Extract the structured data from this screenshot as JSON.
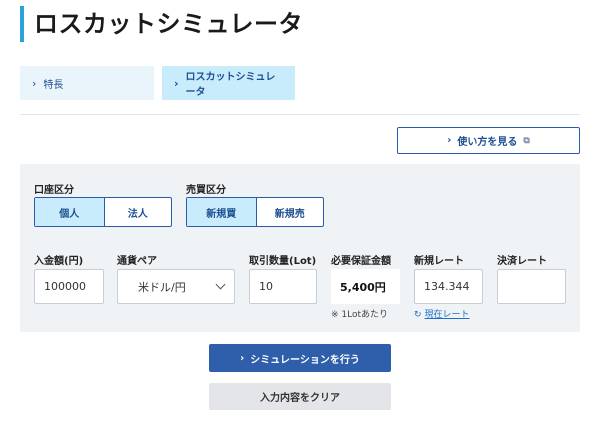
{
  "page": {
    "title": "ロスカットシミュレータ"
  },
  "tabs": [
    {
      "label": "特長"
    },
    {
      "label": "ロスカットシミュレータ"
    }
  ],
  "help_button": {
    "label": "使い方を見る"
  },
  "account_type": {
    "label": "口座区分",
    "options": [
      "個人",
      "法人"
    ],
    "selected": "個人"
  },
  "trade_type": {
    "label": "売買区分",
    "options": [
      "新規買",
      "新規売"
    ],
    "selected": "新規買"
  },
  "fields": {
    "deposit": {
      "label": "入金額(円)",
      "value": "100000"
    },
    "currency_pair": {
      "label": "通貨ペア",
      "value": "米ドル/円"
    },
    "quantity": {
      "label": "取引数量(Lot)",
      "value": "10"
    },
    "margin": {
      "label": "必要保証金額",
      "value": "5,400円",
      "note": "※ 1Lotあたり"
    },
    "new_rate": {
      "label": "新規レート",
      "value": "134.344",
      "link": "現在レート"
    },
    "settle_rate": {
      "label": "決済レート",
      "value": ""
    }
  },
  "buttons": {
    "simulate": "シミュレーションを行う",
    "clear": "入力内容をクリア"
  },
  "icons": {
    "chevron": "chevron-right-icon",
    "external": "external-window-icon",
    "refresh": "refresh-icon",
    "caret": "chevron-down-icon"
  },
  "colors": {
    "accent": "#2aa3d8",
    "primary": "#2f5fab",
    "active_bg": "#c8ecfb"
  }
}
